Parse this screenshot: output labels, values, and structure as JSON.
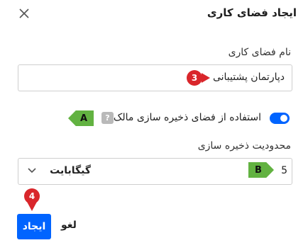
{
  "dialog": {
    "title": "ایجاد فضای کاری",
    "close_icon": "close-icon"
  },
  "workspace_name": {
    "label": "نام فضای کاری",
    "value": "دپارتمان پشتیبانی"
  },
  "owner_storage": {
    "label": "استفاده از فضای ذخیره سازی مالک",
    "enabled": true,
    "help_symbol": "?"
  },
  "storage_limit": {
    "label": "محدودیت ذخیره سازی",
    "value": "5",
    "unit": "گیگابایت"
  },
  "actions": {
    "create_label": "ایجاد",
    "cancel_label": "لغو"
  },
  "annotations": {
    "a": "A",
    "b": "B",
    "step3": "3",
    "step4": "4"
  },
  "colors": {
    "accent": "#0064ff",
    "marker_green": "#62b241",
    "marker_red": "#d9262b"
  }
}
